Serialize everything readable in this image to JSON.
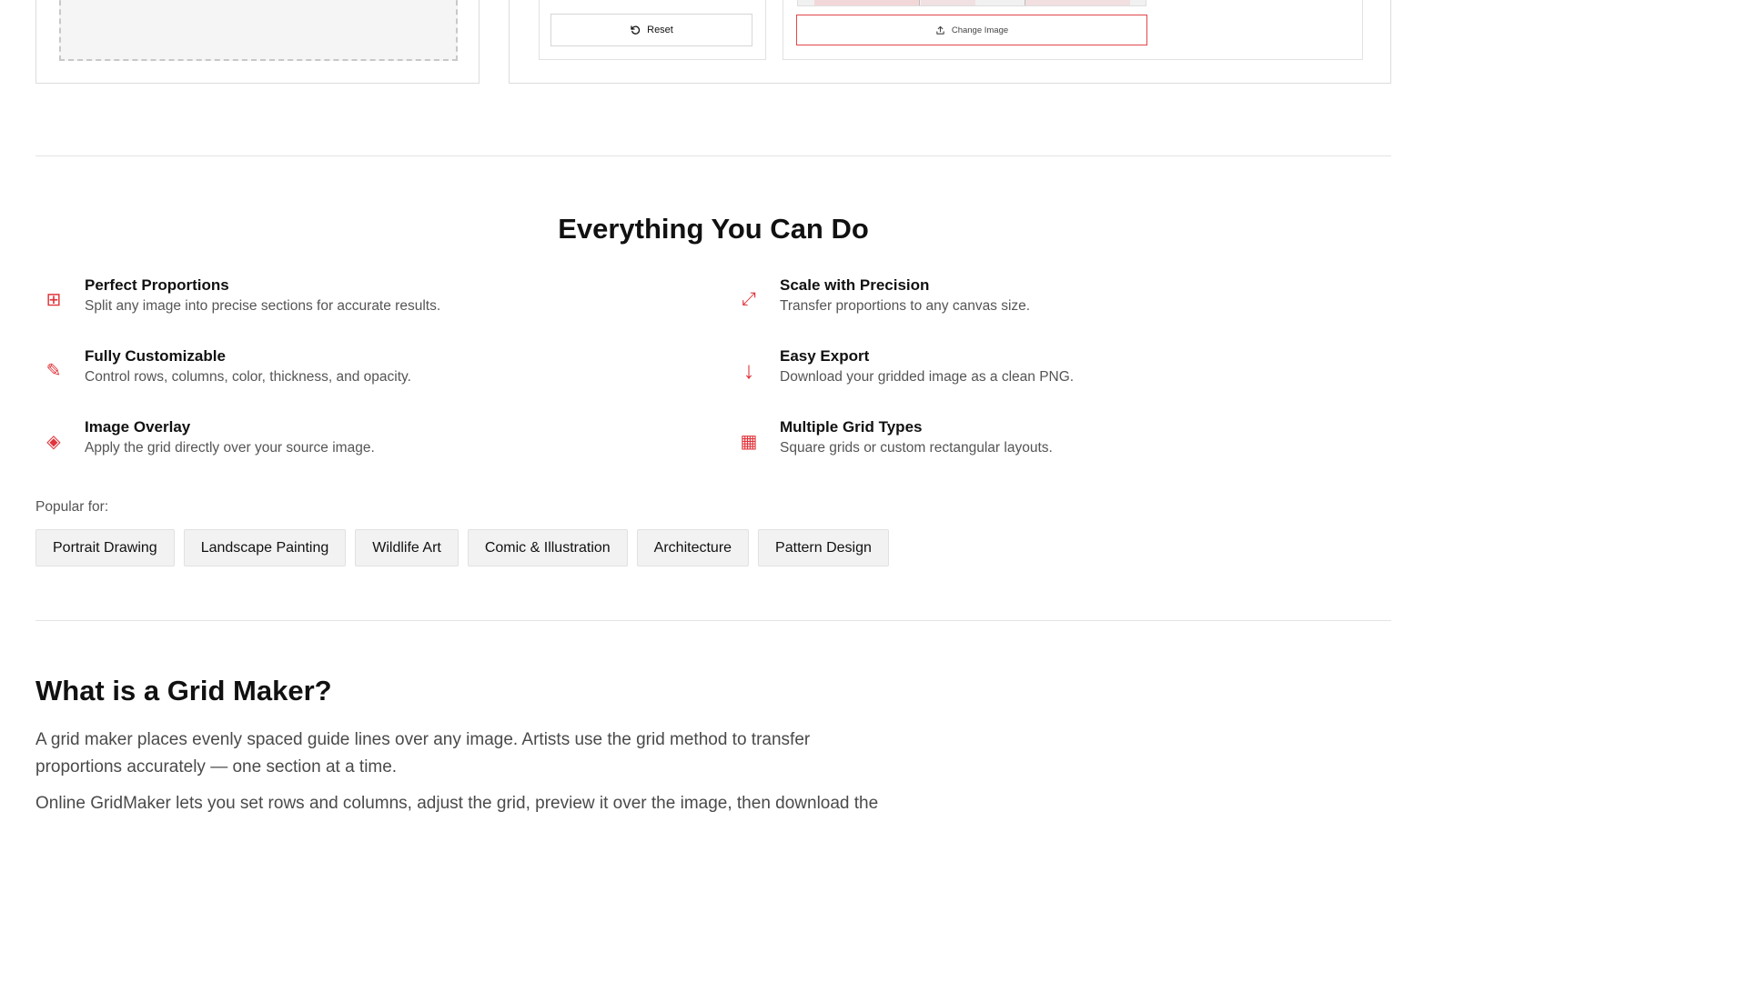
{
  "tool": {
    "reset_label": "Reset",
    "change_image_label": "Change Image"
  },
  "features_section": {
    "title": "Everything You Can Do",
    "items": [
      {
        "icon": "grid-icon",
        "glyph": "⊞",
        "title": "Perfect Proportions",
        "desc": "Split any image into precise sections for accurate results."
      },
      {
        "icon": "expand-icon",
        "glyph": "⤢",
        "title": "Scale with Precision",
        "desc": "Transfer proportions to any canvas size."
      },
      {
        "icon": "pencil-icon",
        "glyph": "✎",
        "title": "Fully Customizable",
        "desc": "Control rows, columns, color, thickness, and opacity."
      },
      {
        "icon": "arrow-down-icon",
        "glyph": "↓",
        "title": "Easy Export",
        "desc": "Download your gridded image as a clean PNG."
      },
      {
        "icon": "diamond-icon",
        "glyph": "◈",
        "title": "Image Overlay",
        "desc": "Apply the grid directly over your source image."
      },
      {
        "icon": "grid-square-icon",
        "glyph": "▦",
        "title": "Multiple Grid Types",
        "desc": "Square grids or custom rectangular layouts."
      }
    ],
    "popular_label": "Popular for:",
    "tags": [
      "Portrait Drawing",
      "Landscape Painting",
      "Wildlife Art",
      "Comic & Illustration",
      "Architecture",
      "Pattern Design"
    ]
  },
  "about": {
    "title": "What is a Grid Maker?",
    "paragraph": "A grid maker places evenly spaced guide lines over any image. Artists use the grid method to transfer proportions accurately — one section at a time.",
    "paragraph2": "Online GridMaker lets you set rows and columns, adjust the grid, preview it over the image, then download the result as PNG."
  },
  "colors": {
    "accent": "#e0353b",
    "text": "#111111",
    "muted": "#555555"
  }
}
